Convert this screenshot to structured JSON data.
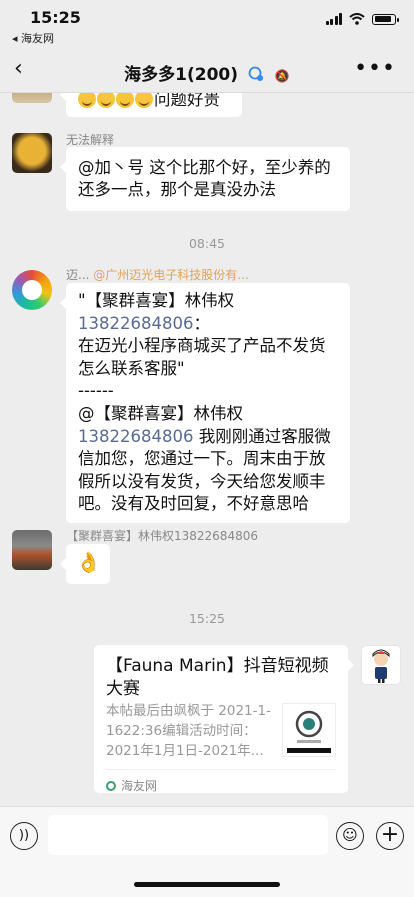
{
  "status_bar": {
    "time": "15:25",
    "back_app": "◂ 海友网"
  },
  "nav": {
    "back_icon": "back-chevron-icon",
    "title": "海多多1(200)",
    "more_icon": "more-icon"
  },
  "messages": [
    {
      "type": "text",
      "partial": true,
      "text_tail": "问题好贵",
      "emoji_count": 4
    },
    {
      "type": "text",
      "sender": "无法解释",
      "text": "@加丶号 这个比那个好，至少养的还多一点，那个是真没办法"
    },
    {
      "type": "timestamp",
      "text": "08:45"
    },
    {
      "type": "text",
      "sender_prefix": "迈...",
      "sender": "@广州迈光电子科技股份有...",
      "line1": "\"【聚群喜宴】林伟权",
      "phone1": "13822684806",
      "line1_tail": "：",
      "line2": "在迈光小程序商城买了产品不发货怎么联系客服\"",
      "line3": "------",
      "line4": "@【聚群喜宴】林伟权",
      "phone2": "13822684806",
      "line5": "  我刚刚通过客服微信加您，您通过一下。周末由于放假所以没有发货，今天给您发顺丰吧。没有及时回复，不好意思哈"
    },
    {
      "type": "emoji",
      "sender": "【聚群喜宴】林伟权13822684806",
      "emoji": "👌"
    },
    {
      "type": "timestamp",
      "text": "15:25"
    },
    {
      "type": "card",
      "title": "【Fauna Marin】抖音短视频大赛",
      "desc": "本帖最后由飒枫于 2021-1-1622:36编辑活动时间：2021年1月1日-2021年...",
      "source": "海友网"
    }
  ],
  "input_bar": {
    "voice_icon": "voice-icon",
    "emoji_icon": "emoji-icon",
    "plus_icon": "plus-icon"
  }
}
